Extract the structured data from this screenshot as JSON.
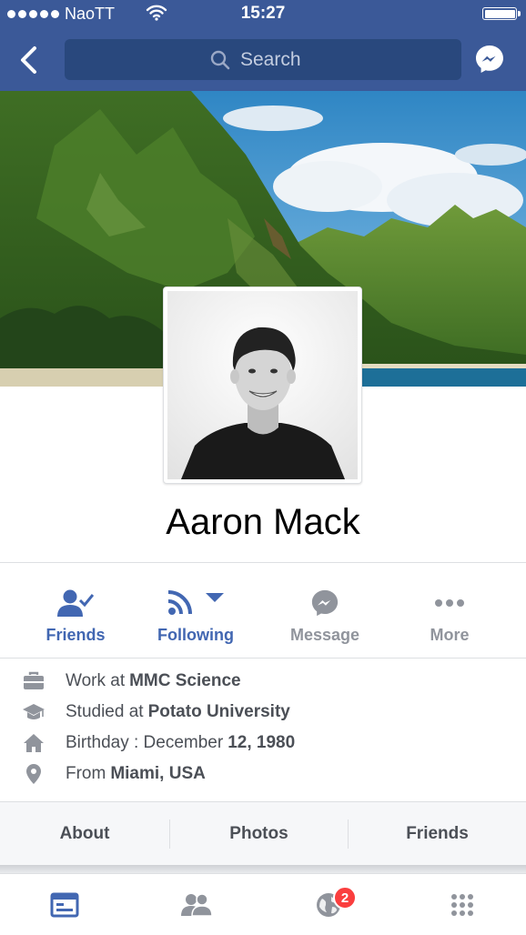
{
  "status_bar": {
    "carrier": "NaoTT",
    "time": "15:27"
  },
  "nav": {
    "search": {
      "placeholder": "Search"
    },
    "colors": {
      "bar": "#3b5998",
      "search_field": "#29487d"
    }
  },
  "profile": {
    "name": "Aaron Mack"
  },
  "actions": [
    {
      "label": "Friends",
      "icon": "friends-check-icon",
      "active": true
    },
    {
      "label": "Following",
      "icon": "rss-following-icon",
      "active": true
    },
    {
      "label": "Message",
      "icon": "messenger-icon",
      "active": false
    },
    {
      "label": "More",
      "icon": "more-dots-icon",
      "active": false
    }
  ],
  "info": [
    {
      "icon": "briefcase-icon",
      "prefix": "Work at",
      "value": "MMC Science"
    },
    {
      "icon": "graduation-cap-icon",
      "prefix": "Studied at",
      "value": "Potato University"
    },
    {
      "icon": "home-icon",
      "prefix": "Birthday : December",
      "value": "12, 1980"
    },
    {
      "icon": "location-pin-icon",
      "prefix": "From",
      "value": "Miami, USA"
    }
  ],
  "tabs": [
    {
      "label": "About"
    },
    {
      "label": "Photos"
    },
    {
      "label": "Friends"
    }
  ],
  "bottom_nav": [
    {
      "icon": "news-feed-icon",
      "active": true
    },
    {
      "icon": "friend-requests-icon",
      "active": false
    },
    {
      "icon": "notifications-globe-icon",
      "active": false,
      "badge": "2"
    },
    {
      "icon": "menu-grid-icon",
      "active": false
    }
  ],
  "accent_colors": {
    "blue": "#4267b2",
    "grey": "#90949c",
    "badge": "#fa3e3e"
  }
}
